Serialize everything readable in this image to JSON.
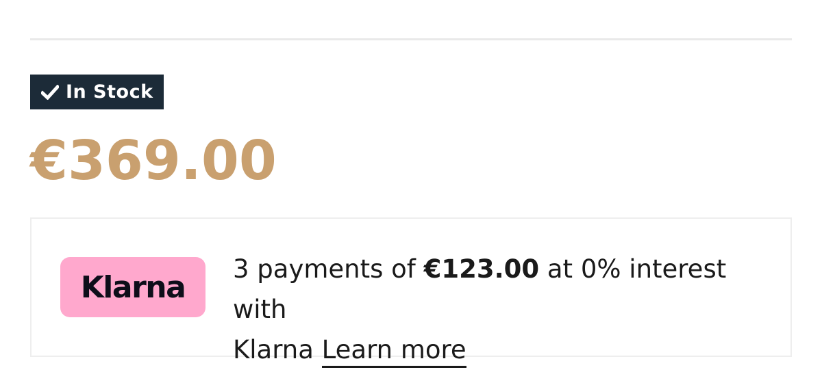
{
  "stock": {
    "icon": "check-icon",
    "label": "In Stock",
    "badge_color": "#1c2b38"
  },
  "price": {
    "value": "€369.00",
    "color": "#c9a06f"
  },
  "klarna": {
    "logo_text": "Klarna",
    "logo_color": "#ffa8cd",
    "message_prefix": "3 payments of ",
    "installment_amount": "€123.00",
    "message_suffix": " at 0% interest with",
    "message_line2": "Klarna",
    "learn_more_label": "Learn more"
  }
}
